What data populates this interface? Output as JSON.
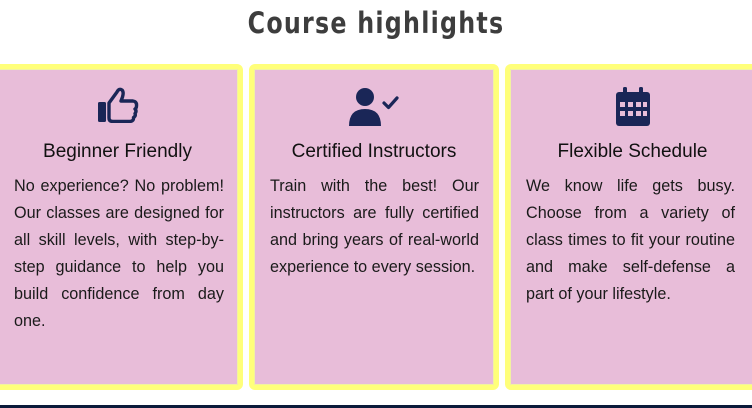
{
  "section": {
    "title": "Course highlights"
  },
  "colors": {
    "card_bg": "#e8bdd9",
    "card_border": "#ffff7a",
    "icon": "#1a2657",
    "title": "#3d3d3d"
  },
  "cards": [
    {
      "icon": "thumbs-up-icon",
      "title": "Beginner Friendly",
      "text": "No experience? No problem! Our classes are designed for all skill levels, with step-by-step guidance to help you build confidence from day one."
    },
    {
      "icon": "user-check-icon",
      "title": "Certified Instructors",
      "text": "Train with the best! Our instructors are fully certified and bring years of real-world experience to every session."
    },
    {
      "icon": "calendar-icon",
      "title": "Flexible Schedule",
      "text": "We know life gets busy. Choose from a variety of class times to fit your routine and make self-defense a part of your lifestyle."
    }
  ]
}
